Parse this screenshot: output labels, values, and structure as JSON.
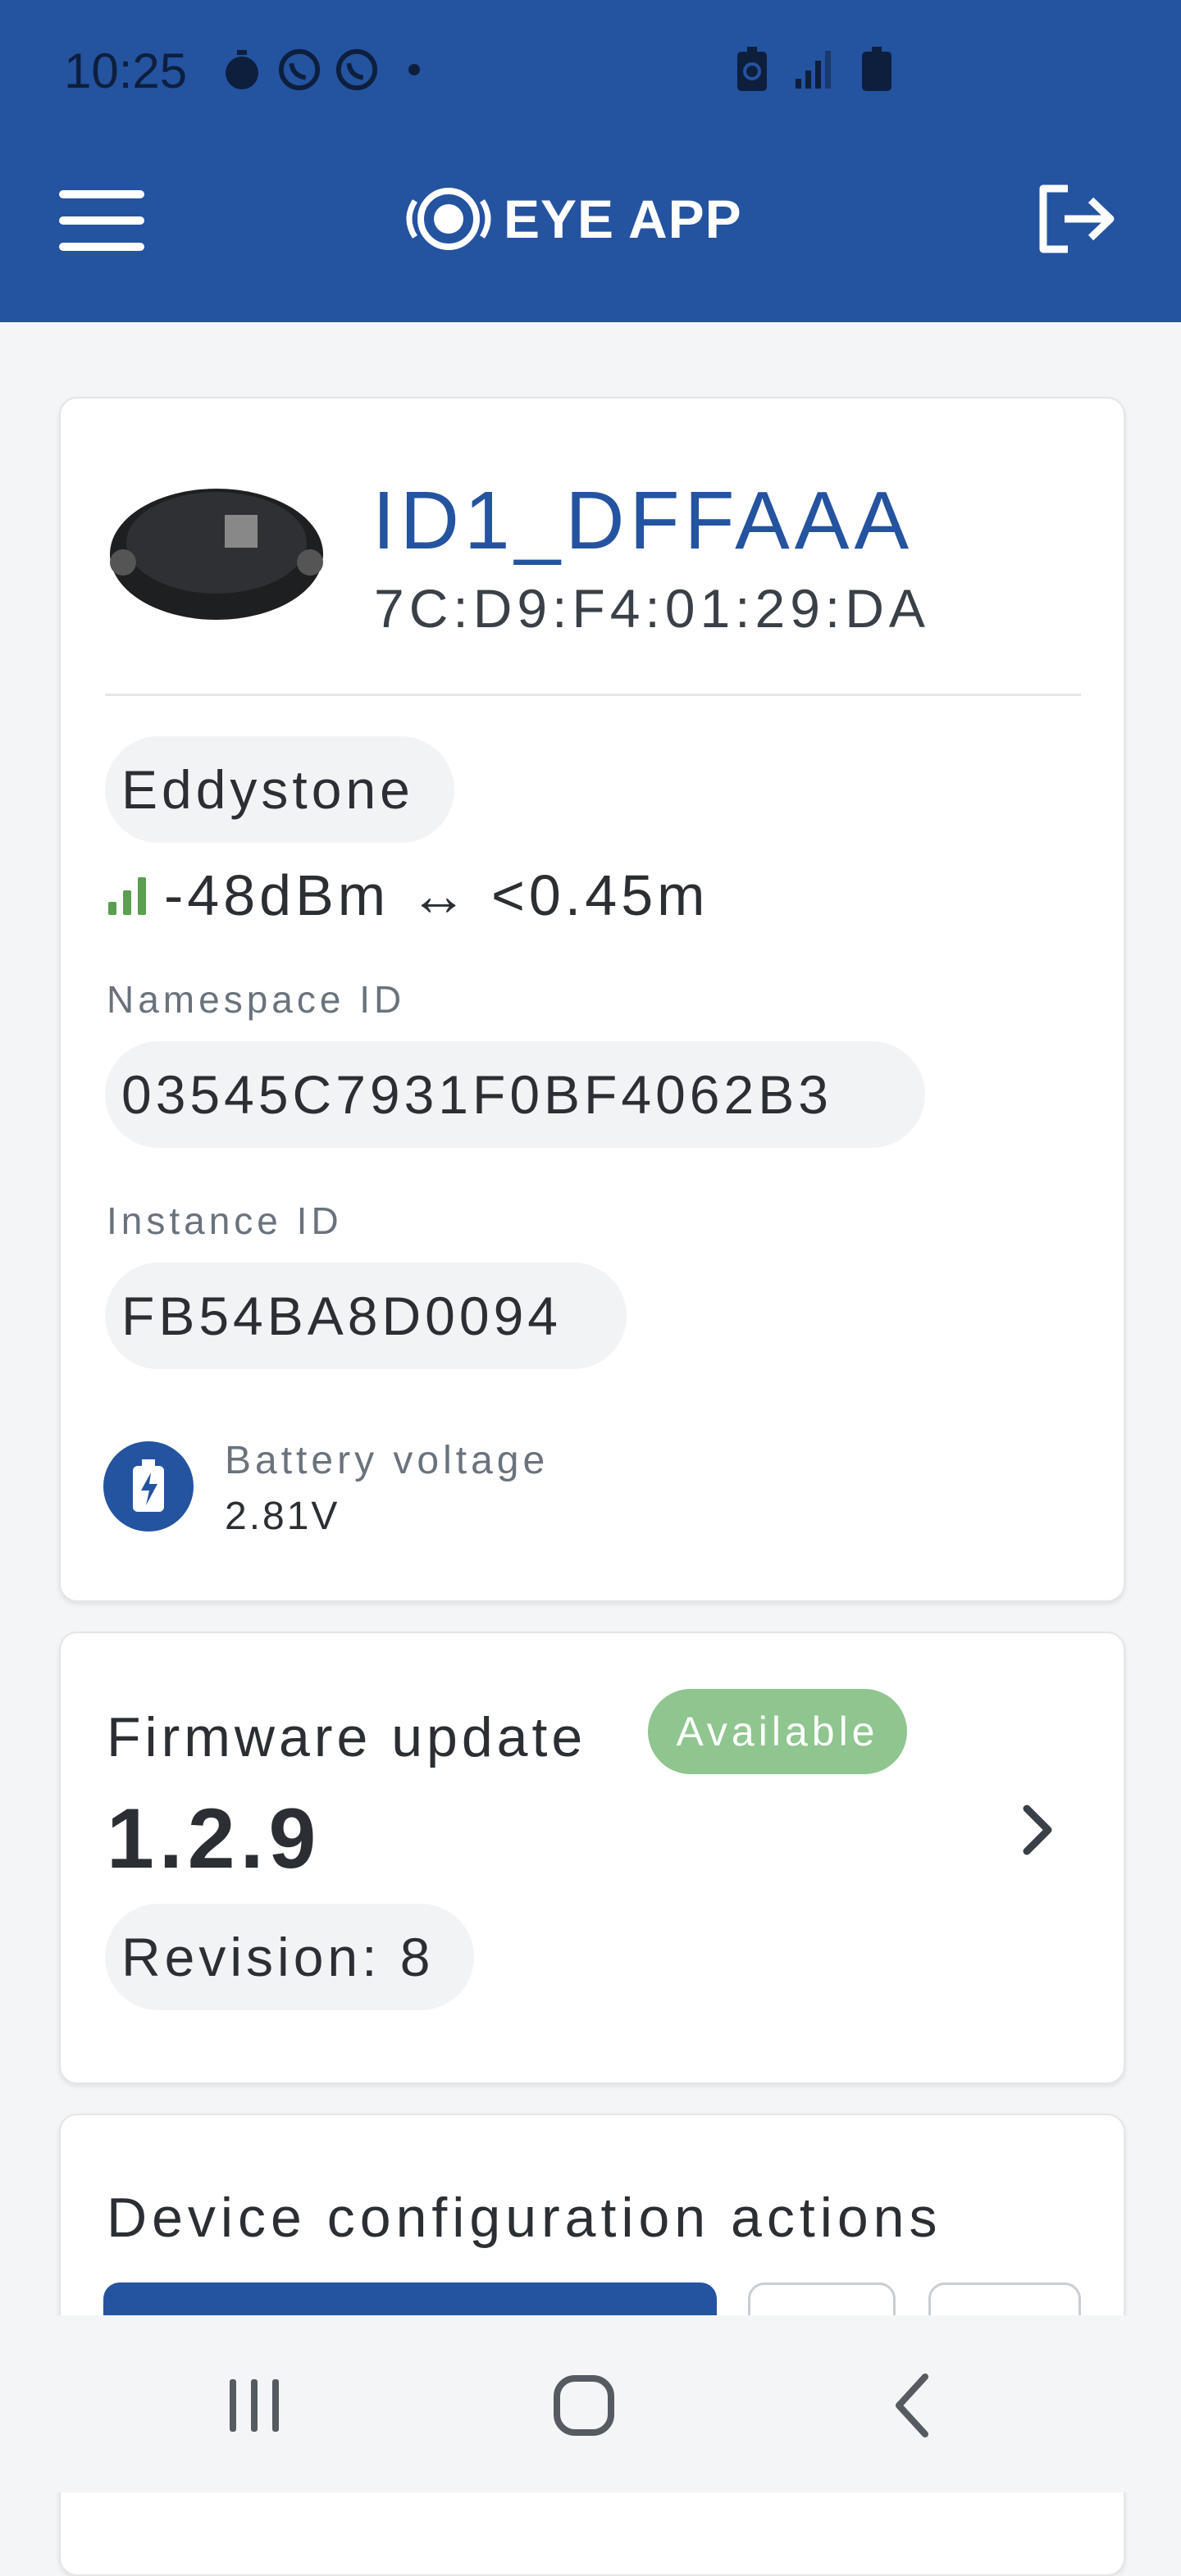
{
  "status_bar": {
    "time": "10:25",
    "icons_left": [
      "stopwatch-icon",
      "whatsapp-icon",
      "whatsapp-icon",
      "dot-icon"
    ],
    "icons_right": [
      "battery-saver-icon",
      "signal-icon",
      "battery-icon"
    ]
  },
  "header": {
    "title": "EYE APP",
    "menu_icon": "hamburger-menu-icon",
    "logout_icon": "logout-icon",
    "background": "#2453a0"
  },
  "device": {
    "name": "ID1_DFFAAA",
    "mac": "7C:D9:F4:01:29:DA",
    "protocol": "Eddystone",
    "signal": "-48dBm ↔ <0.45m",
    "namespace_label": "Namespace ID",
    "namespace_value": "03545C7931F0BF4062B3",
    "instance_label": "Instance ID",
    "instance_value": "FB54BA8D0094",
    "battery_label": "Battery voltage",
    "battery_value": "2.81V",
    "signal_color": "#5a9e4f"
  },
  "firmware": {
    "title": "Firmware update",
    "badge": "Available",
    "badge_color": "#8fc58e",
    "version": "1.2.9",
    "revision": "Revision: 8"
  },
  "device_config": {
    "title": "Device configuration actions"
  },
  "navbar": {
    "icons": [
      "recent-apps-icon",
      "home-icon",
      "back-icon"
    ]
  }
}
